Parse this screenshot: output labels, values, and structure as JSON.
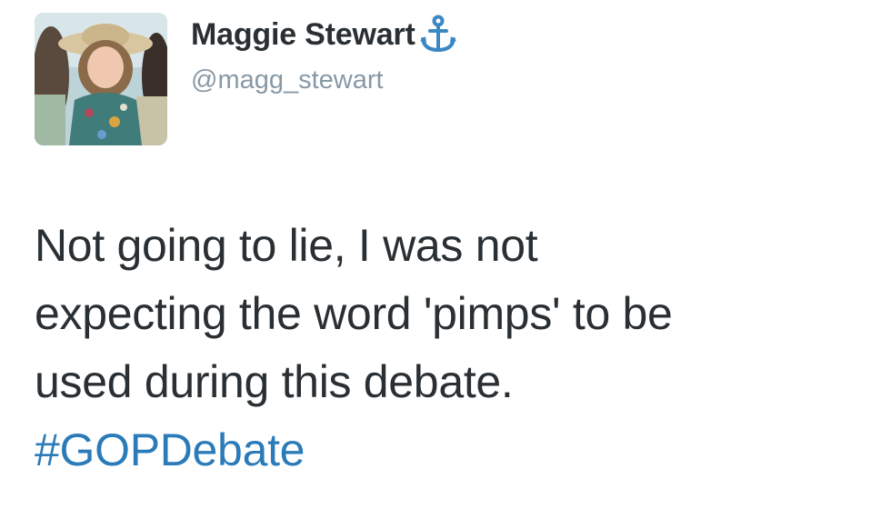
{
  "tweet": {
    "author": {
      "display_name": "Maggie Stewart",
      "name_icon": "anchor-icon",
      "handle": "@magg_stewart",
      "avatar_icon": "profile-photo"
    },
    "text_lines": [
      "Not going to lie, I was not",
      "expecting the word 'pimps' to be",
      "used during this debate."
    ],
    "hashtag": "#GOPDebate"
  },
  "colors": {
    "name": "#292f33",
    "handle": "#8899a6",
    "hashtag": "#2b7bb9",
    "anchor": "#3b88c3"
  }
}
